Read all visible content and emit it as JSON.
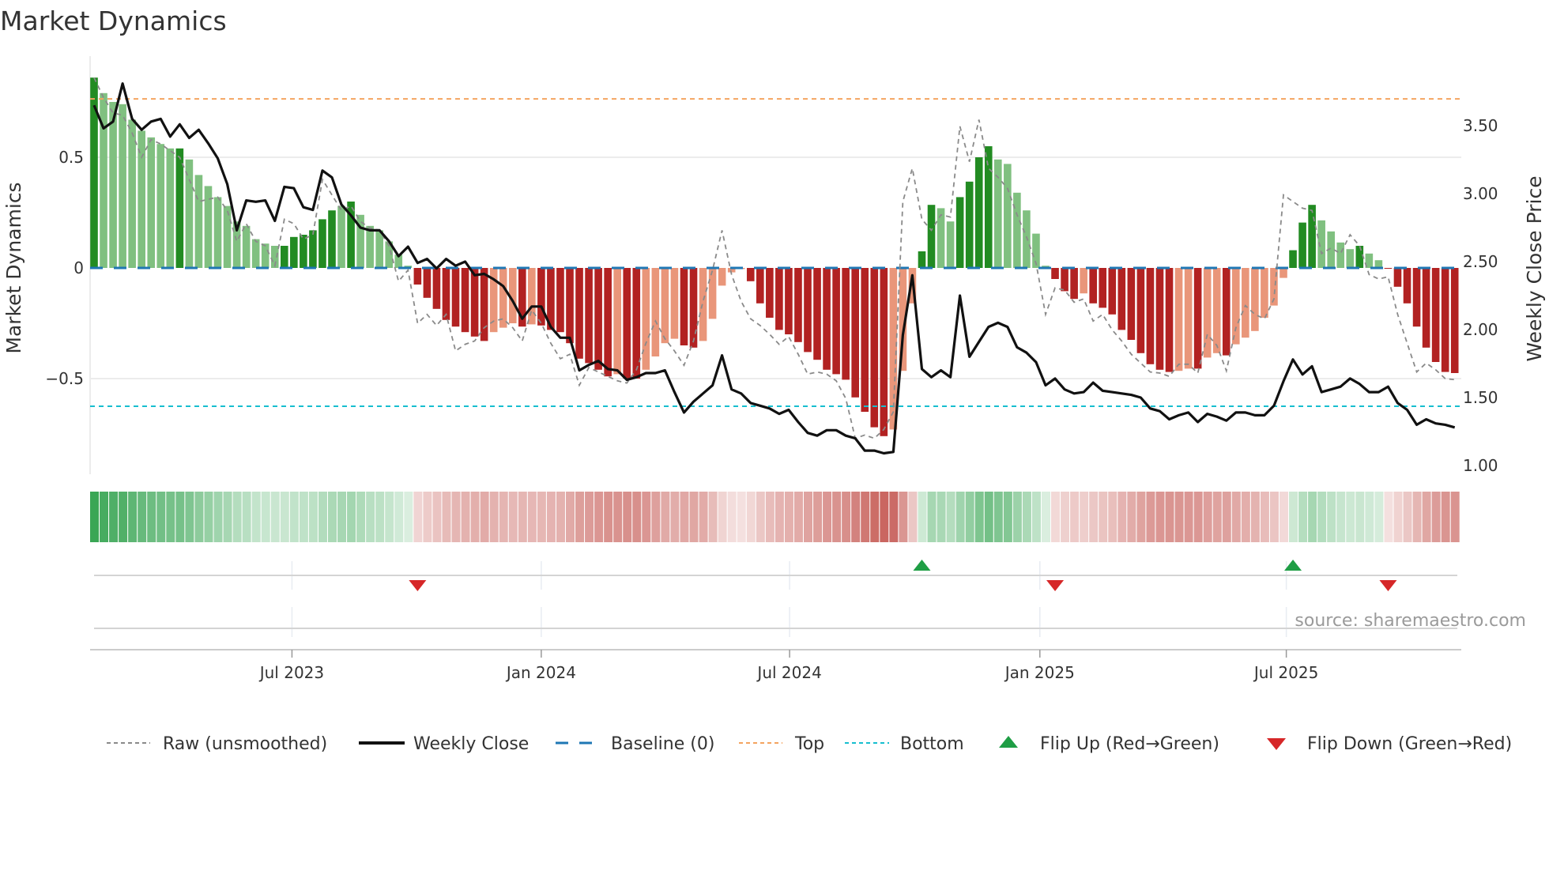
{
  "chart_data": {
    "type": "bar",
    "title": "Market Dynamics",
    "ylabel": "Market Dynamics",
    "y2label": "Weekly Close Price",
    "ylim": [
      -0.93,
      0.92
    ],
    "y2lim": [
      0.94,
      3.95
    ],
    "y_ticks": [
      {
        "v": 0.5,
        "label": "0.5"
      },
      {
        "v": 0,
        "label": "0"
      },
      {
        "v": -0.5,
        "label": "−0.5"
      }
    ],
    "y2_ticks": [
      {
        "v": 3.5,
        "label": "3.50"
      },
      {
        "v": 3.0,
        "label": "3.00"
      },
      {
        "v": 2.5,
        "label": "2.50"
      },
      {
        "v": 2.0,
        "label": "2.00"
      },
      {
        "v": 1.5,
        "label": "1.50"
      },
      {
        "v": 1.0,
        "label": "1.00"
      }
    ],
    "x_unit": "week index",
    "x_ticks": [
      {
        "week": 20.8,
        "label": "Jul 2023"
      },
      {
        "week": 47.0,
        "label": "Jan 2024"
      },
      {
        "week": 73.1,
        "label": "Jul 2024"
      },
      {
        "week": 99.4,
        "label": "Jan 2025"
      },
      {
        "week": 125.3,
        "label": "Jul 2025"
      }
    ],
    "top_level": 0.764,
    "bottom_level": -0.625,
    "baseline": 0,
    "dynamics": [
      0.86,
      0.79,
      0.75,
      0.74,
      0.67,
      0.62,
      0.59,
      0.56,
      0.54,
      0.54,
      0.49,
      0.42,
      0.37,
      0.32,
      0.28,
      0.21,
      0.19,
      0.13,
      0.11,
      0.1,
      0.1,
      0.14,
      0.15,
      0.17,
      0.22,
      0.26,
      0.28,
      0.3,
      0.24,
      0.19,
      0.17,
      0.12,
      0.06,
      0.01,
      -0.075,
      -0.135,
      -0.185,
      -0.235,
      -0.265,
      -0.29,
      -0.31,
      -0.33,
      -0.29,
      -0.27,
      -0.25,
      -0.265,
      -0.255,
      -0.26,
      -0.28,
      -0.29,
      -0.34,
      -0.41,
      -0.43,
      -0.46,
      -0.49,
      -0.48,
      -0.5,
      -0.5,
      -0.46,
      -0.4,
      -0.34,
      -0.32,
      -0.35,
      -0.36,
      -0.33,
      -0.23,
      -0.08,
      -0.02,
      -0.005,
      -0.06,
      -0.16,
      -0.225,
      -0.28,
      -0.3,
      -0.335,
      -0.38,
      -0.415,
      -0.46,
      -0.48,
      -0.505,
      -0.585,
      -0.65,
      -0.72,
      -0.76,
      -0.73,
      -0.465,
      -0.16,
      0.075,
      0.285,
      0.27,
      0.21,
      0.32,
      0.39,
      0.5,
      0.55,
      0.49,
      0.47,
      0.34,
      0.26,
      0.155,
      0.01,
      -0.05,
      -0.105,
      -0.14,
      -0.115,
      -0.16,
      -0.18,
      -0.21,
      -0.28,
      -0.325,
      -0.385,
      -0.435,
      -0.46,
      -0.47,
      -0.465,
      -0.455,
      -0.455,
      -0.405,
      -0.385,
      -0.395,
      -0.345,
      -0.315,
      -0.285,
      -0.225,
      -0.17,
      -0.045,
      0.08,
      0.205,
      0.285,
      0.215,
      0.165,
      0.115,
      0.085,
      0.1,
      0.065,
      0.035,
      -0.003,
      -0.085,
      -0.16,
      -0.265,
      -0.36,
      -0.425,
      -0.47,
      -0.475
    ],
    "shade": "DLLLLLLLLDLLLLLLLLLLDDDDDDLDLLLLLLDDDDDDDDLLLDLDDDDDDDDLDDLLLLDDLLLLLDDDDDDDDDDDDDDDLLLDDLLDDDDLLLLLLDDDLDDDDDDDDDLLDLLDLLLLLLDDDLLLLDLLDDDDDDDD",
    "raw": [
      0.86,
      0.77,
      0.7,
      0.69,
      0.61,
      0.5,
      0.58,
      0.56,
      0.53,
      0.5,
      0.4,
      0.3,
      0.31,
      0.32,
      0.26,
      0.12,
      0.2,
      0.12,
      0.1,
      0.01,
      0.22,
      0.2,
      0.13,
      0.15,
      0.4,
      0.33,
      0.26,
      0.28,
      0.21,
      0.18,
      0.17,
      0.1,
      -0.06,
      -0.01,
      -0.25,
      -0.21,
      -0.26,
      -0.21,
      -0.375,
      -0.345,
      -0.33,
      -0.27,
      -0.24,
      -0.23,
      -0.27,
      -0.33,
      -0.19,
      -0.25,
      -0.34,
      -0.41,
      -0.39,
      -0.53,
      -0.45,
      -0.47,
      -0.49,
      -0.51,
      -0.52,
      -0.46,
      -0.34,
      -0.24,
      -0.32,
      -0.375,
      -0.44,
      -0.33,
      -0.15,
      -0.01,
      0.17,
      -0.03,
      -0.15,
      -0.23,
      -0.26,
      -0.3,
      -0.345,
      -0.31,
      -0.39,
      -0.48,
      -0.47,
      -0.48,
      -0.51,
      -0.59,
      -0.77,
      -0.755,
      -0.77,
      -0.73,
      -0.65,
      0.3,
      0.45,
      0.22,
      0.17,
      0.24,
      0.23,
      0.64,
      0.48,
      0.67,
      0.45,
      0.41,
      0.36,
      0.24,
      0.14,
      0.02,
      -0.21,
      -0.09,
      -0.1,
      -0.155,
      -0.14,
      -0.24,
      -0.21,
      -0.28,
      -0.33,
      -0.39,
      -0.43,
      -0.47,
      -0.475,
      -0.49,
      -0.435,
      -0.435,
      -0.475,
      -0.3,
      -0.35,
      -0.465,
      -0.27,
      -0.17,
      -0.21,
      -0.23,
      -0.14,
      0.33,
      0.3,
      0.27,
      0.26,
      0.065,
      0.09,
      0.065,
      0.15,
      0.1,
      -0.03,
      -0.05,
      -0.04,
      -0.21,
      -0.34,
      -0.47,
      -0.43,
      -0.46,
      -0.5,
      -0.505
    ],
    "weekly_close": [
      3.65,
      3.48,
      3.53,
      3.81,
      3.55,
      3.47,
      3.53,
      3.55,
      3.42,
      3.51,
      3.41,
      3.47,
      3.37,
      3.26,
      3.07,
      2.73,
      2.95,
      2.94,
      2.95,
      2.8,
      3.05,
      3.04,
      2.9,
      2.88,
      3.17,
      3.12,
      2.92,
      2.84,
      2.75,
      2.73,
      2.73,
      2.65,
      2.54,
      2.61,
      2.49,
      2.52,
      2.45,
      2.52,
      2.47,
      2.5,
      2.4,
      2.41,
      2.37,
      2.32,
      2.21,
      2.08,
      2.17,
      2.17,
      2.02,
      1.94,
      1.94,
      1.7,
      1.74,
      1.77,
      1.71,
      1.7,
      1.63,
      1.65,
      1.68,
      1.68,
      1.7,
      1.54,
      1.39,
      1.47,
      1.53,
      1.59,
      1.81,
      1.56,
      1.53,
      1.46,
      1.44,
      1.42,
      1.38,
      1.41,
      1.32,
      1.24,
      1.22,
      1.26,
      1.26,
      1.22,
      1.2,
      1.11,
      1.11,
      1.09,
      1.1,
      1.96,
      2.4,
      1.71,
      1.65,
      1.7,
      1.65,
      2.25,
      1.8,
      1.91,
      2.02,
      2.05,
      2.02,
      1.87,
      1.83,
      1.76,
      1.59,
      1.64,
      1.56,
      1.53,
      1.54,
      1.61,
      1.55,
      1.54,
      1.53,
      1.52,
      1.5,
      1.42,
      1.4,
      1.34,
      1.37,
      1.39,
      1.32,
      1.38,
      1.36,
      1.33,
      1.39,
      1.39,
      1.37,
      1.37,
      1.44,
      1.62,
      1.78,
      1.67,
      1.73,
      1.54,
      1.56,
      1.58,
      1.64,
      1.6,
      1.54,
      1.54,
      1.58,
      1.46,
      1.41,
      1.3,
      1.34,
      1.31,
      1.3,
      1.28
    ],
    "flips": [
      {
        "week": 34,
        "dir": "down"
      },
      {
        "week": 87,
        "dir": "up"
      },
      {
        "week": 101,
        "dir": "down"
      },
      {
        "week": 126,
        "dir": "up"
      },
      {
        "week": 136,
        "dir": "down"
      }
    ],
    "legend": {
      "placement": "bottom",
      "raw": "Raw (unsmoothed)",
      "close": "Weekly Close",
      "baseline": "Baseline (0)",
      "top": "Top",
      "bottom": "Bottom",
      "flip_up": "Flip Up (Red→Green)",
      "flip_down": "Flip Down (Green→Red)"
    },
    "source": "source: sharemaestro.com",
    "colors": {
      "green_dark": "#228b22",
      "green_light": "#80c080",
      "red_dark": "#b22222",
      "red_light": "#e9967a",
      "strip_green": "#3aa655",
      "strip_red": "#c45650",
      "raw": "#8a8a8a",
      "close": "#111111",
      "baseline": "#1f77b4",
      "top": "#f4a460",
      "bottom": "#17becf",
      "flip_up": "#1f9e45",
      "flip_down": "#d62728"
    }
  }
}
